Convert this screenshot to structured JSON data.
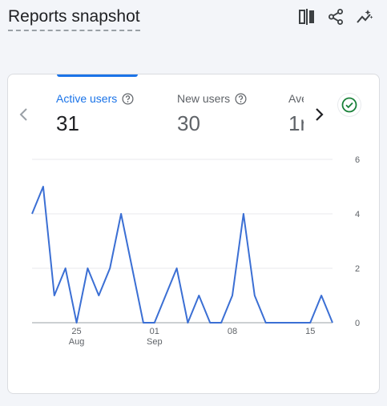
{
  "header": {
    "title": "Reports snapshot"
  },
  "icons": {
    "compare": "compare-icon",
    "share": "share-icon",
    "insights": "insights-icon",
    "prev": "chevron-left-icon",
    "next": "chevron-right-icon",
    "check": "check-circle-icon",
    "help": "help-icon"
  },
  "metrics": [
    {
      "label": "Active users",
      "value": "31"
    },
    {
      "label": "New users",
      "value": "30"
    },
    {
      "label": "Ave",
      "value": "1r"
    }
  ],
  "colors": {
    "accent": "#1a73e8",
    "check": "#188038",
    "line": "#3b6fd4"
  },
  "chart_data": {
    "type": "line",
    "series": [
      {
        "values": [
          4,
          5,
          1,
          2,
          0,
          2,
          1,
          2,
          4,
          2,
          0,
          0,
          1,
          2,
          0,
          1,
          0,
          0,
          1,
          4,
          1,
          0,
          0,
          0,
          0,
          0,
          1,
          0
        ]
      }
    ],
    "x_ticks": [
      {
        "index": 4,
        "day": "25",
        "month": "Aug"
      },
      {
        "index": 11,
        "day": "01",
        "month": "Sep"
      },
      {
        "index": 18,
        "day": "08",
        "month": ""
      },
      {
        "index": 25,
        "day": "15",
        "month": ""
      }
    ],
    "y_ticks": [
      "0",
      "2",
      "4",
      "6"
    ],
    "ylim": [
      0,
      6
    ],
    "grid": true
  }
}
